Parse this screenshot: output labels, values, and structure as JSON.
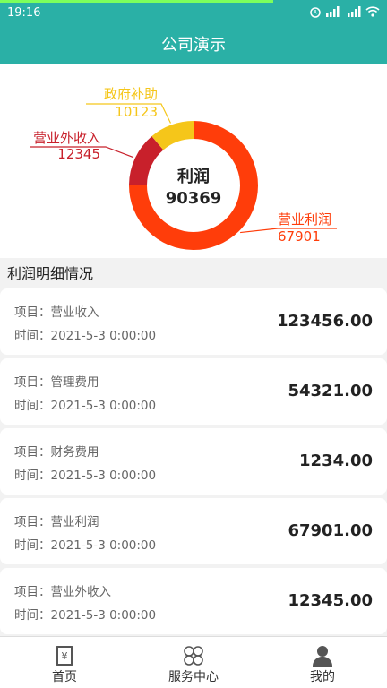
{
  "status_bar": {
    "time": "19:16"
  },
  "app_bar": {
    "title": "公司演示"
  },
  "chart_data": {
    "type": "pie",
    "center_label": "利润",
    "center_value": "90369",
    "slices": [
      {
        "name": "营业利润",
        "value": 67901,
        "color": "#ff3d0a"
      },
      {
        "name": "营业外收入",
        "value": 12345,
        "color": "#c8202b"
      },
      {
        "name": "政府补助",
        "value": 10123,
        "color": "#f5c61a"
      }
    ]
  },
  "section": {
    "title": "利润明细情况"
  },
  "records": [
    {
      "item_label": "项目：营业收入",
      "time_label": "时间：2021-5-3 0:00:00",
      "amount": "123456.00"
    },
    {
      "item_label": "项目：管理费用",
      "time_label": "时间：2021-5-3 0:00:00",
      "amount": "54321.00"
    },
    {
      "item_label": "项目：财务费用",
      "time_label": "时间：2021-5-3 0:00:00",
      "amount": "1234.00"
    },
    {
      "item_label": "项目：营业利润",
      "time_label": "时间：2021-5-3 0:00:00",
      "amount": "67901.00"
    },
    {
      "item_label": "项目：营业外收入",
      "time_label": "时间：2021-5-3 0:00:00",
      "amount": "12345.00"
    }
  ],
  "nav": [
    {
      "label": "首页",
      "icon": "home-book-icon"
    },
    {
      "label": "服务中心",
      "icon": "clover-grid-icon"
    },
    {
      "label": "我的",
      "icon": "person-icon"
    }
  ]
}
